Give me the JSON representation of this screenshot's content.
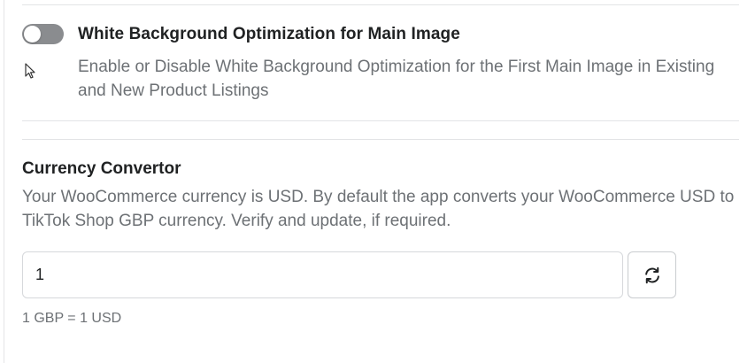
{
  "white_bg": {
    "toggle_state": "off",
    "title": "White Background Optimization for Main Image",
    "description": "Enable or Disable White Background Optimization for the First Main Image in Existing and New Product Listings"
  },
  "currency": {
    "title": "Currency Convertor",
    "description": "Your WooCommerce currency is USD. By default the app converts your WooCommerce USD to TikTok Shop GBP currency. Verify and update, if required.",
    "rate_value": "1",
    "refresh_icon": "refresh-icon",
    "rate_caption": "1 GBP = 1 USD"
  },
  "colors": {
    "toggle_off": "#8a8c8f",
    "muted_text": "#6d7175",
    "heading_text": "#202223"
  }
}
